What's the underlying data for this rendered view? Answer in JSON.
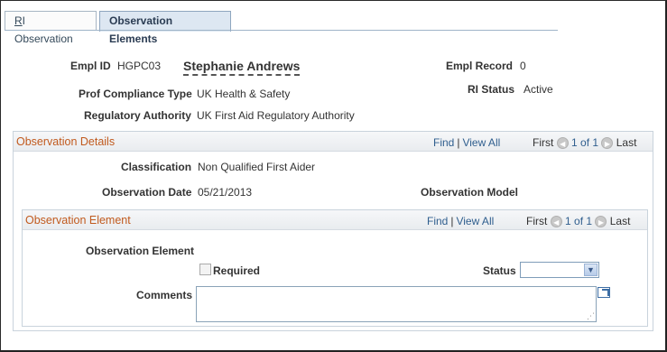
{
  "tabs": [
    {
      "label_prefix": "R",
      "label_rest": "I Observation"
    },
    {
      "label": "Observation Elements"
    }
  ],
  "header": {
    "empl_id_label": "Empl ID",
    "empl_id": "HGPC03",
    "employee_name": "Stephanie Andrews",
    "empl_record_label": "Empl Record",
    "empl_record": "0",
    "prof_compliance_label": "Prof Compliance Type",
    "prof_compliance": "UK Health & Safety",
    "ri_status_label": "RI Status",
    "ri_status": "Active",
    "reg_authority_label": "Regulatory Authority",
    "reg_authority": "UK First Aid Regulatory Authority"
  },
  "observation_details": {
    "title": "Observation Details",
    "find": "Find",
    "sep": "|",
    "view_all": "View All",
    "first": "First",
    "prev_icon": "◀",
    "page": "1 of 1",
    "next_icon": "▶",
    "last": "Last",
    "classification_label": "Classification",
    "classification": "Non Qualified First Aider",
    "observation_date_label": "Observation Date",
    "observation_date": "05/21/2013",
    "observation_model_label": "Observation Model"
  },
  "observation_element": {
    "title": "Observation Element",
    "find": "Find",
    "sep": "|",
    "view_all": "View All",
    "first": "First",
    "prev_icon": "◀",
    "page": "1 of 1",
    "next_icon": "▶",
    "last": "Last",
    "element_label": "Observation Element",
    "required_label": "Required",
    "required_checked": false,
    "status_label": "Status",
    "status_value": "",
    "dropdown_icon": "▼",
    "comments_label": "Comments",
    "comments_value": "",
    "resize_grip": "⋰"
  }
}
